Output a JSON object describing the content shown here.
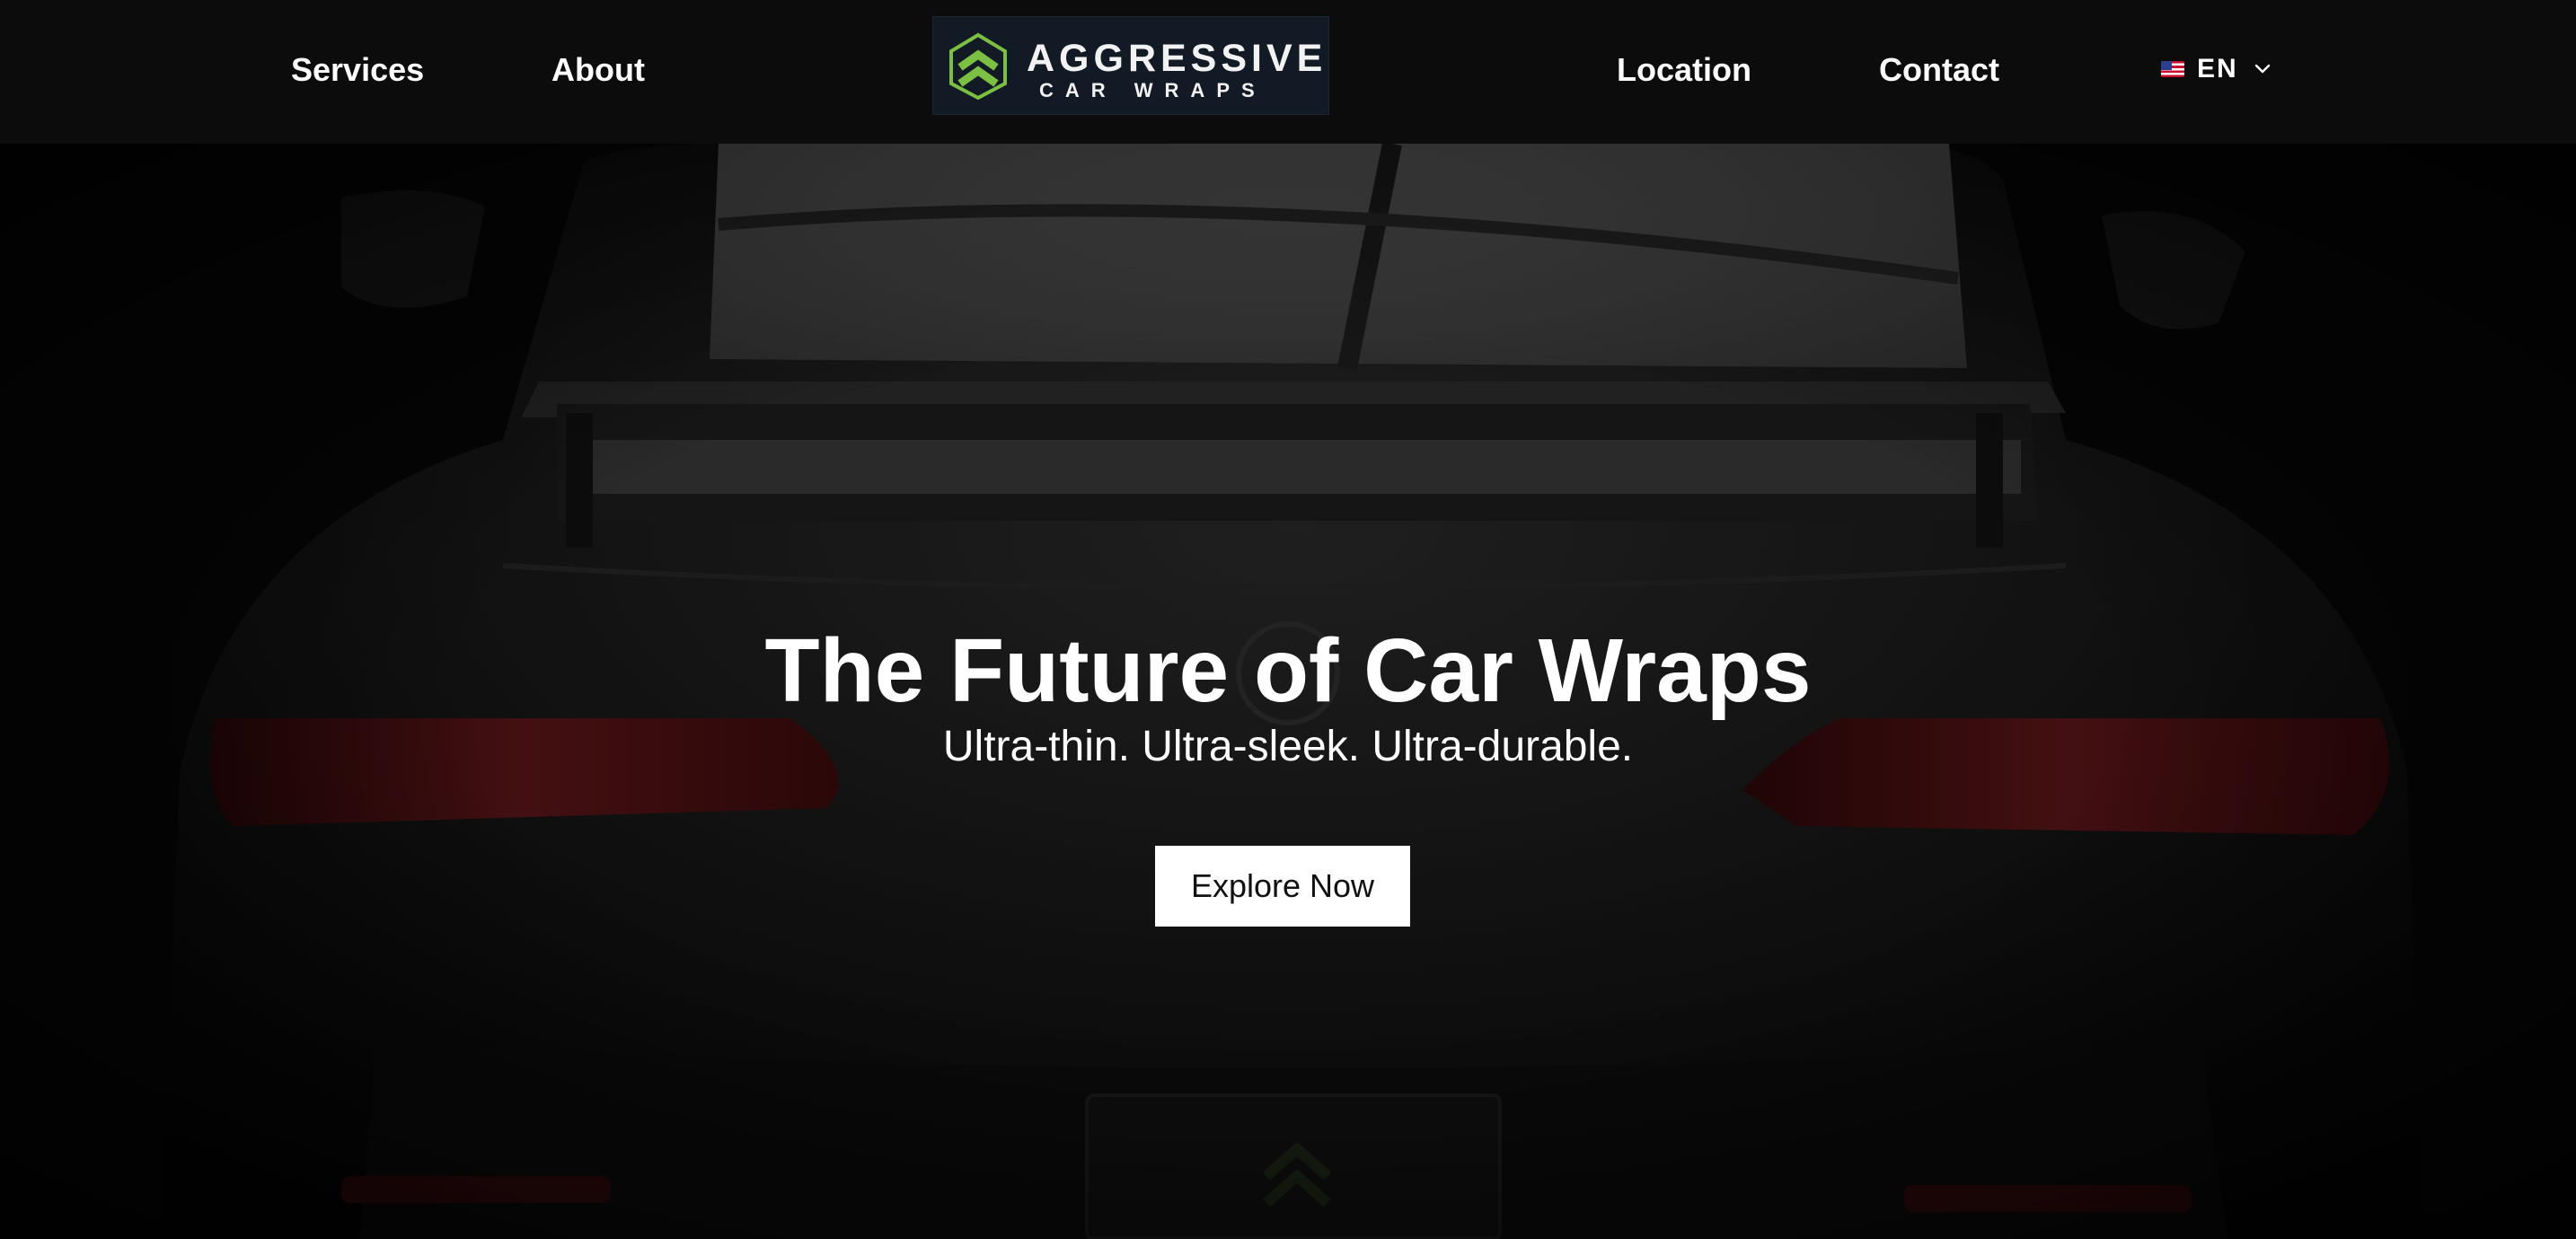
{
  "nav": {
    "services": "Services",
    "about": "About",
    "location": "Location",
    "contact": "Contact"
  },
  "logo": {
    "main": "AGGRESSIVE",
    "sub": "CAR WRAPS",
    "icon": "chevron-shield-icon",
    "accent": "#7bc043",
    "background": "#121a26"
  },
  "language": {
    "flag": "us-flag-icon",
    "code": "EN",
    "dropdown_icon": "chevron-down-icon"
  },
  "hero": {
    "title": "The Future of Car Wraps",
    "subtitle": "Ultra-thin. Ultra-sleek. Ultra-durable.",
    "cta_label": "Explore Now",
    "background_image": "matte black sports car rear view"
  },
  "colors": {
    "navbar": "#0c0c0c",
    "text": "#ffffff",
    "cta_bg": "#ffffff",
    "cta_text": "#111111"
  }
}
